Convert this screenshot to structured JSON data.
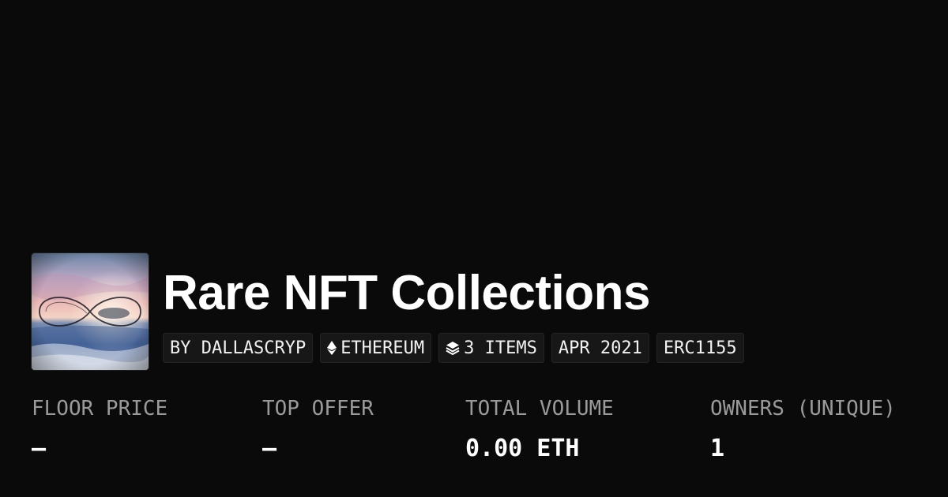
{
  "collection": {
    "title": "Rare NFT Collections",
    "avatar": {
      "icon": "infinity-ocean-sunset-image"
    }
  },
  "tags": [
    {
      "label": "BY DALLASCRYP",
      "icon": ""
    },
    {
      "label": "ETHEREUM",
      "icon": "ethereum-icon"
    },
    {
      "label": "3 ITEMS",
      "icon": "layers-icon"
    },
    {
      "label": "APR 2021",
      "icon": ""
    },
    {
      "label": "ERC1155",
      "icon": ""
    }
  ],
  "stats": [
    {
      "label": "FLOOR PRICE",
      "value": "–"
    },
    {
      "label": "TOP OFFER",
      "value": "–"
    },
    {
      "label": "TOTAL VOLUME",
      "value": "0.00 ETH"
    },
    {
      "label": "OWNERS (UNIQUE)",
      "value": "1"
    }
  ],
  "colors": {
    "background": "#0a0a0a",
    "tag_background": "#171717",
    "label": "#9a9a9a",
    "text": "#ffffff"
  }
}
